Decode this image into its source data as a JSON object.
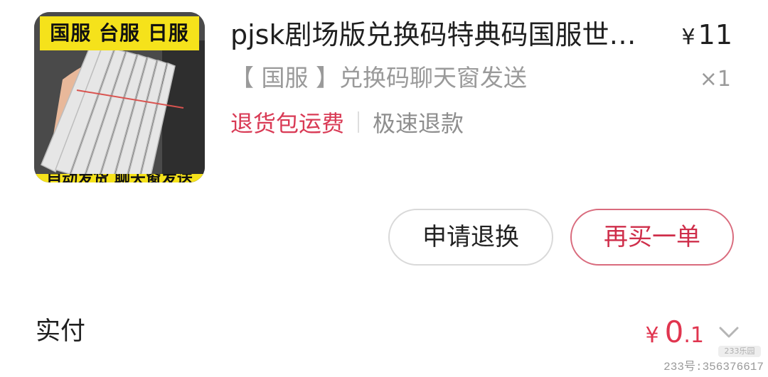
{
  "product": {
    "thumbnail": {
      "banner_text": "国服 台服 日服",
      "footer_text": "自动发货 聊天窗发送"
    },
    "title": "pjsk剧场版兑换码特典码国服世…",
    "price": {
      "currency": "¥",
      "value": "11"
    },
    "spec": "【 国服 】兑换码聊天窗发送",
    "quantity": "×1",
    "tags": {
      "return_shipping": "退货包运费",
      "fast_refund": "极速退款"
    }
  },
  "actions": {
    "refund_label": "申请退换",
    "rebuy_label": "再买一单"
  },
  "payment": {
    "label": "实付",
    "currency": "¥",
    "integer": "0",
    "decimal": ".1",
    "expand_icon": "chevron-down-icon"
  },
  "watermark": {
    "logo_text": "233乐园",
    "text": "233号:356376617"
  },
  "colors": {
    "accent_red": "#d93a55",
    "price_red": "#e0354f",
    "rebuy_border": "#d96b7d",
    "muted_gray": "#9a9a9a"
  }
}
